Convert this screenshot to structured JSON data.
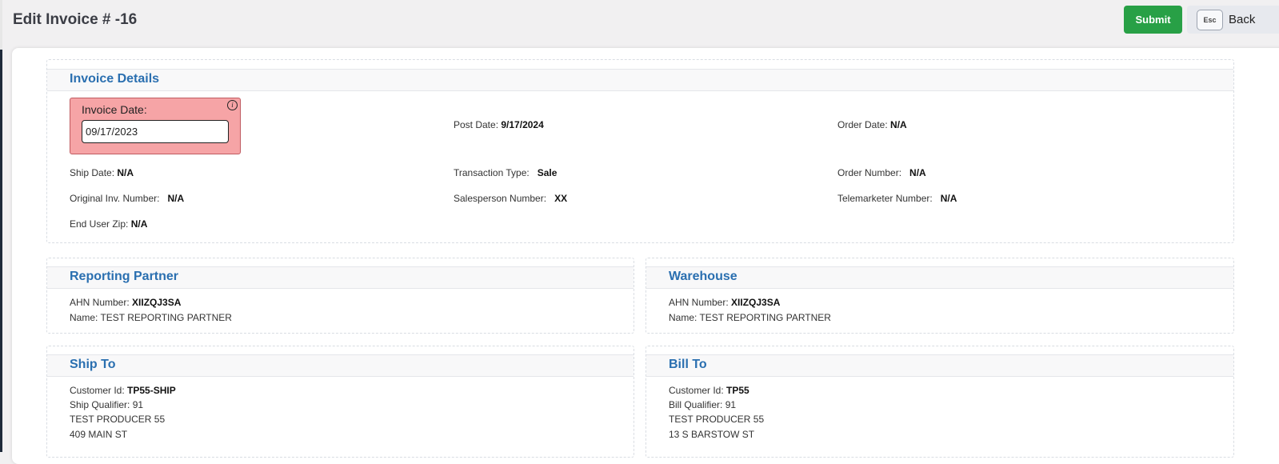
{
  "header": {
    "title": "Edit Invoice # -16",
    "submit_label": "Submit",
    "back_key": "Esc",
    "back_label": "Back"
  },
  "invoice_details": {
    "title": "Invoice Details",
    "invoice_date_label": "Invoice Date:",
    "invoice_date_value": "09/17/2023",
    "post_date_label": "Post Date:",
    "post_date_value": "9/17/2024",
    "order_date_label": "Order Date:",
    "order_date_value": "N/A",
    "ship_date_label": "Ship Date:",
    "ship_date_value": "N/A",
    "transaction_type_label": "Transaction Type:",
    "transaction_type_value": "Sale",
    "order_number_label": "Order Number:",
    "order_number_value": "N/A",
    "original_inv_label": "Original Inv. Number:",
    "original_inv_value": "N/A",
    "salesperson_label": "Salesperson Number:",
    "salesperson_value": "XX",
    "telemarketer_label": "Telemarketer Number:",
    "telemarketer_value": "N/A",
    "end_user_zip_label": "End User Zip:",
    "end_user_zip_value": "N/A"
  },
  "reporting_partner": {
    "title": "Reporting Partner",
    "ahn_label": "AHN Number:",
    "ahn_value": "XIIZQJ3SA",
    "name_label": "Name:",
    "name_value": "TEST REPORTING PARTNER"
  },
  "warehouse": {
    "title": "Warehouse",
    "ahn_label": "AHN Number:",
    "ahn_value": "XIIZQJ3SA",
    "name_label": "Name:",
    "name_value": "TEST REPORTING PARTNER"
  },
  "ship_to": {
    "title": "Ship To",
    "customer_id_label": "Customer Id:",
    "customer_id_value": "TP55-SHIP",
    "qualifier_label": "Ship Qualifier:",
    "qualifier_value": "91",
    "line1": "TEST PRODUCER 55",
    "line2": "409 MAIN ST"
  },
  "bill_to": {
    "title": "Bill To",
    "customer_id_label": "Customer Id:",
    "customer_id_value": "TP55",
    "qualifier_label": "Bill Qualifier:",
    "qualifier_value": "91",
    "line1": "TEST PRODUCER 55",
    "line2": "13 S BARSTOW ST"
  },
  "colors": {
    "accent": "#2a6fb0",
    "submit": "#28a046",
    "invalid_field_bg": "#f6a4a6"
  }
}
